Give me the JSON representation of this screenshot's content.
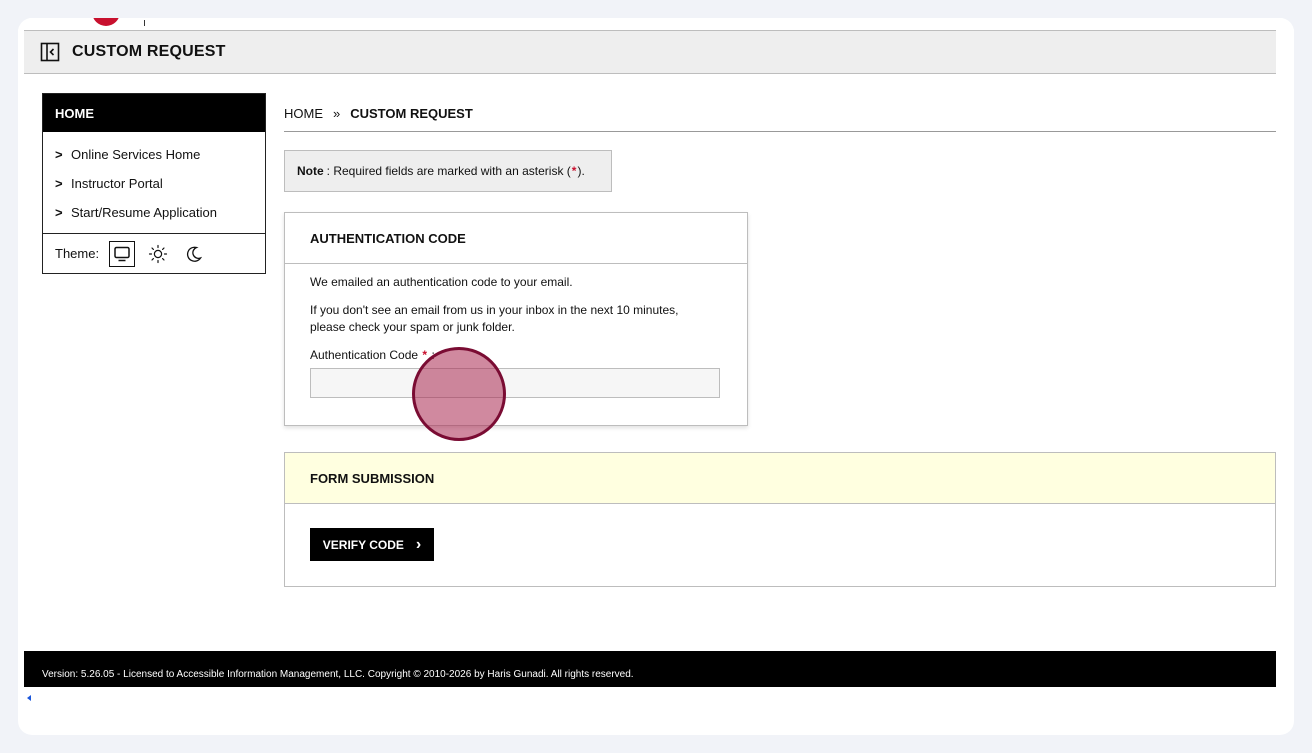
{
  "colors": {
    "accent": "#c8102e",
    "header_bg": "#eeeeee",
    "sidebar_head_bg": "#000000",
    "form_submission_bg": "#ffffe0",
    "footer_bg": "#000000"
  },
  "header": {
    "title": "CUSTOM REQUEST",
    "collapse_icon": "sidebar-collapse-icon"
  },
  "sidebar": {
    "heading": "HOME",
    "items": [
      {
        "label": "Online Services Home"
      },
      {
        "label": "Instructor Portal"
      },
      {
        "label": "Start/Resume Application"
      }
    ],
    "theme_label": "Theme:",
    "theme_options": [
      "monitor-icon",
      "sun-icon",
      "moon-icon"
    ],
    "theme_selected": "monitor-icon"
  },
  "breadcrumb": {
    "home": "HOME",
    "separator": "»",
    "current": "CUSTOM REQUEST"
  },
  "note": {
    "label": "Note",
    "text": ": Required fields are marked with an asterisk (",
    "asterisk": "*",
    "end": ")."
  },
  "auth_card": {
    "title": "AUTHENTICATION CODE",
    "line1": "We emailed an authentication code to your email.",
    "line2a": "If you don't see an email from us in your inbox in the next 10 minutes,",
    "line2b": "please check your spam or junk folder.",
    "field_label": "Authentication Code",
    "field_required": "*",
    "field_colon": ":",
    "field_value": ""
  },
  "form_submission": {
    "title": "FORM SUBMISSION",
    "verify_label": "VERIFY CODE",
    "verify_arrow": "›"
  },
  "footer": {
    "text": "Version: 5.26.05 - Licensed to Accessible Information Management, LLC. Copyright © 2010-2026 by Haris Gunadi. All rights reserved."
  }
}
